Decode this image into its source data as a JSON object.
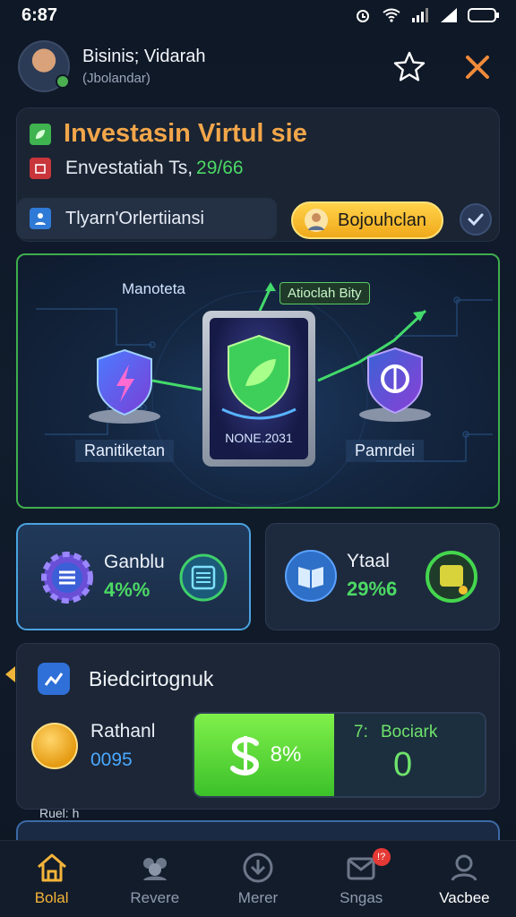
{
  "status_bar": {
    "time": "6:87"
  },
  "header": {
    "name": "Bisinis; Vidarah",
    "subtitle": "(Jbolandar)"
  },
  "top_card": {
    "title": "Investasin Virtul sie",
    "line_label": "Envestatiah Ts,",
    "line_value": "29/66",
    "pill_text": "Tlyarn'Orlertiiansi",
    "button_label": "Bojouhclan"
  },
  "hero": {
    "label_top_left": "Manoteta",
    "label_tag": "Atioclah Bity",
    "tablet_text": "NONE.2031",
    "left_caption": "Ranitiketan",
    "right_caption": "Pamrdei"
  },
  "stats": [
    {
      "label": "Ganblu",
      "value": "4%%"
    },
    {
      "label": "Ytaal",
      "value": "29%6"
    }
  ],
  "bottom_card": {
    "title": "Biedcirtognuk",
    "left_label": "Rathanl",
    "left_value": "0095",
    "green_text": "8%",
    "right_label": "Bociark",
    "right_prefix": "7:",
    "right_value": "0"
  },
  "peek_text": "Ruel: h",
  "nav": [
    {
      "label": "Bolal",
      "icon": "home-icon",
      "badge": ""
    },
    {
      "label": "Revere",
      "icon": "group-icon",
      "badge": ""
    },
    {
      "label": "Merer",
      "icon": "download-icon",
      "badge": ""
    },
    {
      "label": "Sngas",
      "icon": "mail-icon",
      "badge": "!?"
    },
    {
      "label": "Vacbee",
      "icon": "profile-icon",
      "badge": ""
    }
  ],
  "colors": {
    "accent_orange": "#f2a64a",
    "accent_green": "#4cd964",
    "nav_active": "#f4b43a",
    "hero_border": "#3fae4d"
  }
}
